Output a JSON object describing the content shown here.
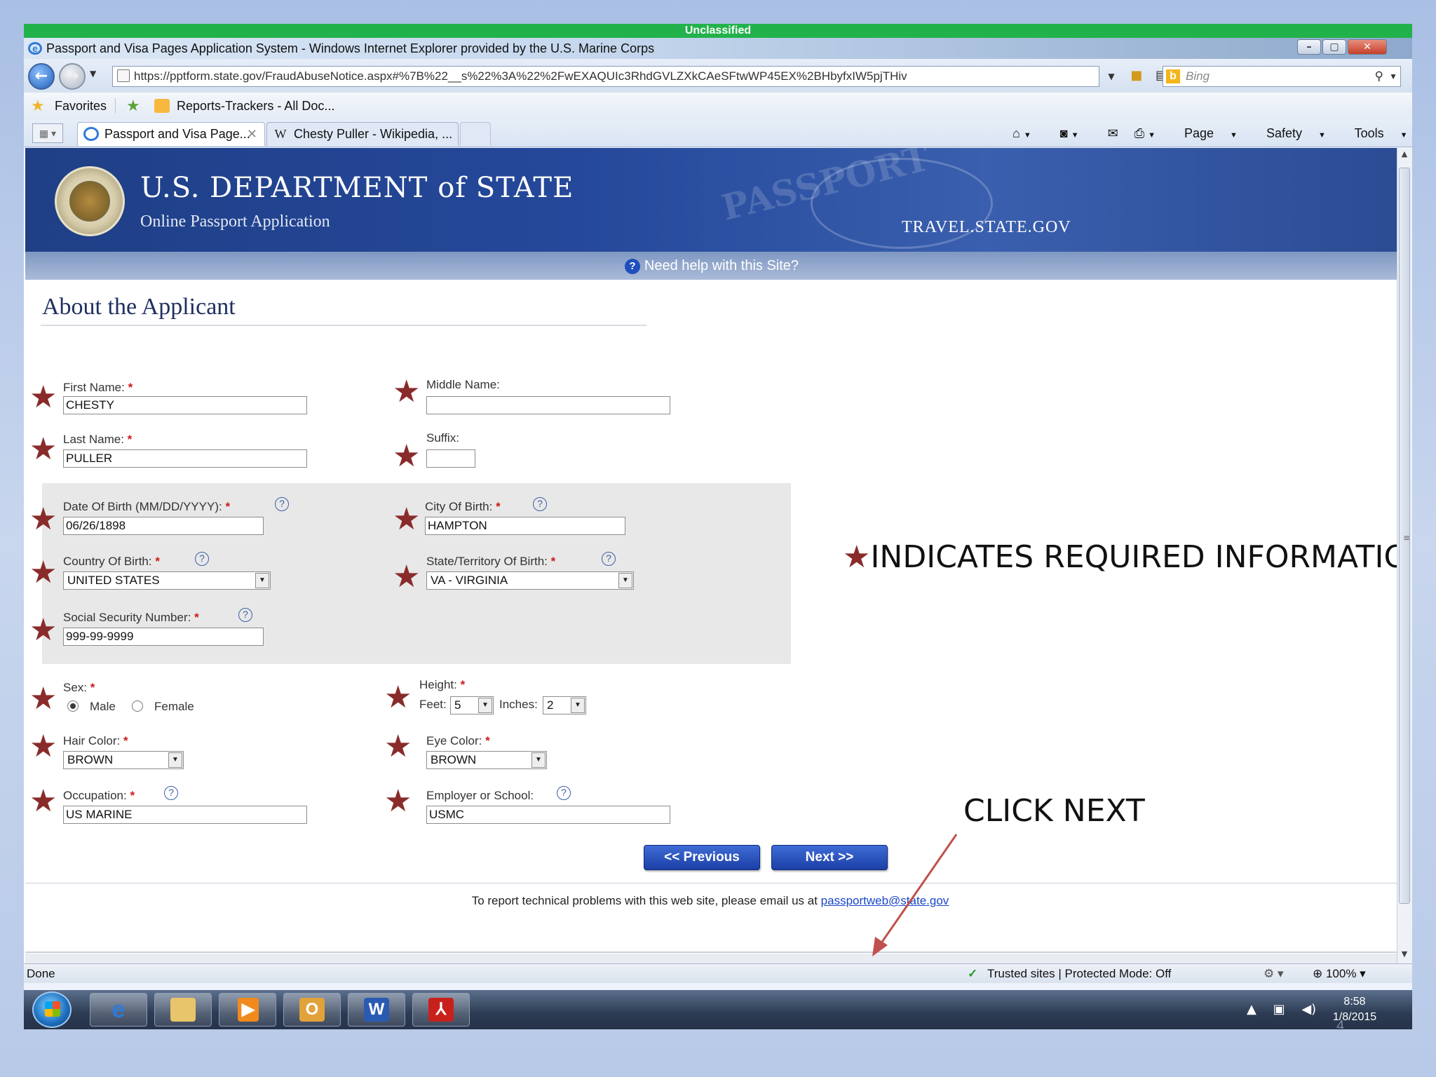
{
  "classification": "Unclassified",
  "window": {
    "title": "Passport and Visa Pages Application System - Windows Internet Explorer provided by the U.S. Marine Corps",
    "controls": {
      "minimize": "–",
      "maximize": "▢",
      "close": "✕"
    }
  },
  "navigation": {
    "back_glyph": "←",
    "forward_glyph": "→",
    "url": "https://pptform.state.gov/FraudAbuseNotice.aspx#%7B%22__s%22%3A%22%2FwEXAQUIc3RhdGVLZXkCAeSFtwWP45EX%2BHbyfxIW5pjTHiv",
    "search_placeholder": "Bing",
    "icons": [
      "lock-icon",
      "compat-view-icon",
      "refresh-icon",
      "stop-icon",
      "search-icon"
    ]
  },
  "favorites_bar": {
    "favorites_label": "Favorites",
    "items": [
      {
        "label": "Reports-Trackers - All Doc..."
      }
    ]
  },
  "tabs": [
    {
      "label": "Passport and Visa Page...",
      "active": true
    },
    {
      "label": "Chesty Puller - Wikipedia, ...",
      "active": false
    }
  ],
  "command_bar": {
    "page": "Page",
    "safety": "Safety",
    "tools": "Tools"
  },
  "site_header": {
    "department": "U.S. DEPARTMENT of STATE",
    "subtitle": "Online Passport Application",
    "watermark": "PASSPORT",
    "site_url": "TRAVEL.STATE.GOV",
    "help_text": "Need help with this Site?"
  },
  "form": {
    "section_title": "About the Applicant",
    "required_mark": "*",
    "fields": {
      "first_name": {
        "label": "First Name:",
        "value": "CHESTY"
      },
      "middle_name": {
        "label": "Middle Name:",
        "value": ""
      },
      "last_name": {
        "label": "Last Name:",
        "value": "PULLER"
      },
      "suffix": {
        "label": "Suffix:",
        "value": ""
      },
      "dob": {
        "label": "Date Of Birth (MM/DD/YYYY):",
        "value": "06/26/1898"
      },
      "city_of_birth": {
        "label": "City Of Birth:",
        "value": "HAMPTON"
      },
      "country_of_birth": {
        "label": "Country Of Birth:",
        "value": "UNITED STATES"
      },
      "state_of_birth": {
        "label": "State/Territory Of Birth:",
        "value": "VA - VIRGINIA"
      },
      "ssn": {
        "label": "Social Security Number:",
        "value": "999-99-9999"
      },
      "sex": {
        "label": "Sex:",
        "options": [
          "Male",
          "Female"
        ],
        "selected": "Male"
      },
      "height": {
        "label": "Height:",
        "feet_label": "Feet:",
        "feet": "5",
        "inches_label": "Inches:",
        "inches": "2"
      },
      "hair_color": {
        "label": "Hair Color:",
        "value": "BROWN"
      },
      "eye_color": {
        "label": "Eye Color:",
        "value": "BROWN"
      },
      "occupation": {
        "label": "Occupation:",
        "value": "US MARINE"
      },
      "employer": {
        "label": "Employer or School:",
        "value": "USMC"
      }
    },
    "previous_button": "<< Previous",
    "next_button": "Next >>",
    "footer_text": "To report technical problems with this web site, please email us at ",
    "footer_email": "passportweb@state.gov"
  },
  "annotations": {
    "required_note": "INDICATES REQUIRED INFORMATION",
    "click_next": "CLICK NEXT",
    "star_color": "#8a2b2b",
    "arrow_color": "#c0504d"
  },
  "status_bar": {
    "left": "Done",
    "zone": "Trusted sites | Protected Mode: Off",
    "zoom": "100%"
  },
  "taskbar": {
    "apps": [
      "internet-explorer",
      "file-explorer",
      "media-player",
      "outlook",
      "word",
      "acrobat"
    ],
    "time": "8:58",
    "date": "1/8/2015"
  },
  "slide_number": "4"
}
